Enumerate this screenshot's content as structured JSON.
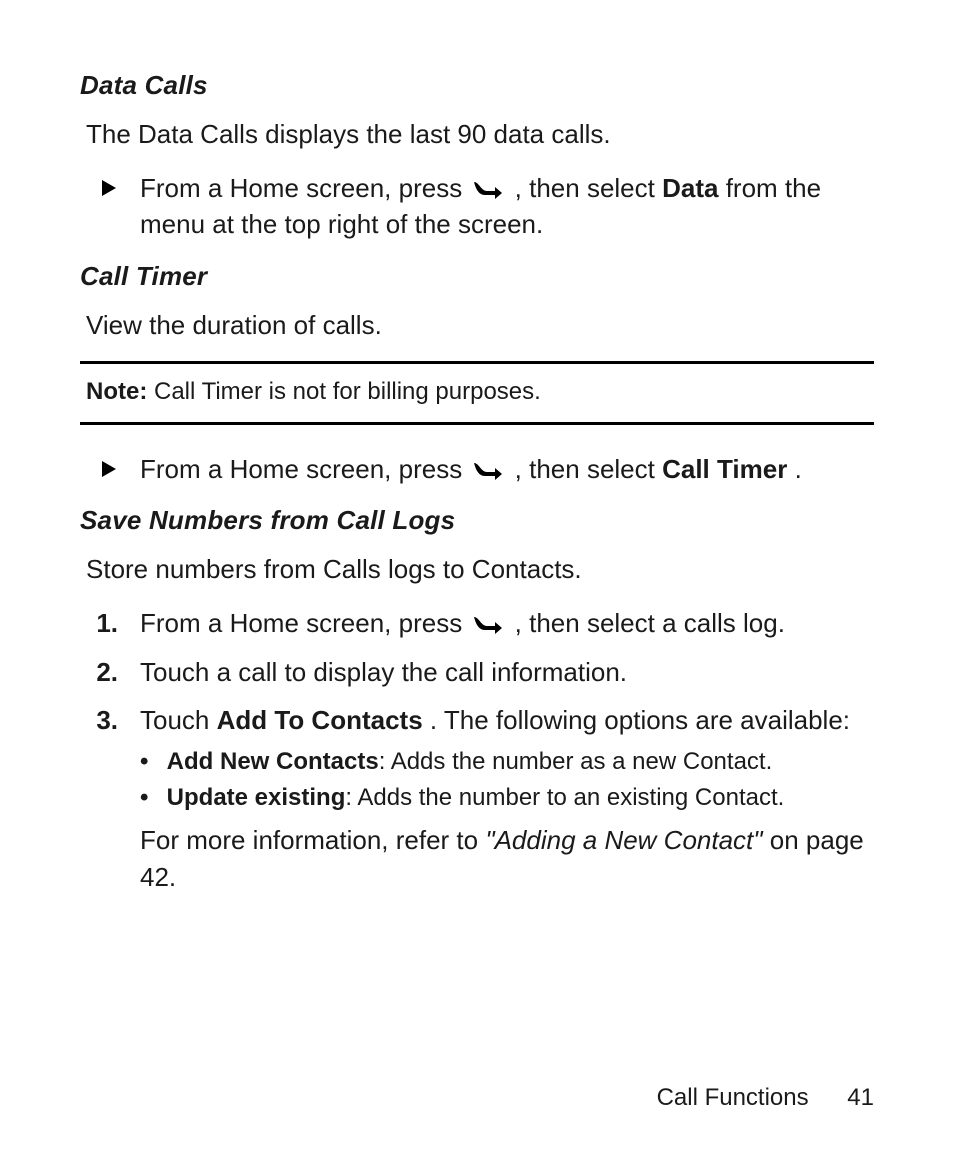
{
  "sections": {
    "data_calls": {
      "heading": "Data Calls",
      "intro": "The Data Calls displays the last 90 data calls.",
      "step_pre": "From a Home screen, press ",
      "step_mid": ", then select ",
      "step_bold": "Data",
      "step_post": " from the menu at the top right of the screen."
    },
    "call_timer": {
      "heading": "Call Timer",
      "intro": "View the duration of calls.",
      "note_label": "Note:",
      "note_text": " Call Timer is not for billing purposes.",
      "step_pre": "From a Home screen, press ",
      "step_mid": ", then select ",
      "step_bold": "Call Timer",
      "step_post": "."
    },
    "save_numbers": {
      "heading": "Save Numbers from Call Logs",
      "intro": "Store numbers from Calls logs to Contacts.",
      "steps": {
        "s1": {
          "num": "1.",
          "pre": "From a Home screen, press ",
          "post": ", then select a calls log."
        },
        "s2": {
          "num": "2.",
          "text": "Touch a call to display the call information."
        },
        "s3": {
          "num": "3.",
          "pre": "Touch ",
          "bold": "Add To Contacts",
          "post": ". The following options are available:",
          "b1_bold": "Add New Contacts",
          "b1_rest": ": Adds the number as a new Contact.",
          "b2_bold": "Update existing",
          "b2_rest": ": Adds the number to an existing Contact.",
          "follow_pre": "For more information, refer to ",
          "follow_ital": "\"Adding a New Contact\"",
          "follow_post": " on page 42."
        }
      }
    }
  },
  "footer": {
    "section": "Call Functions",
    "page": "41"
  }
}
